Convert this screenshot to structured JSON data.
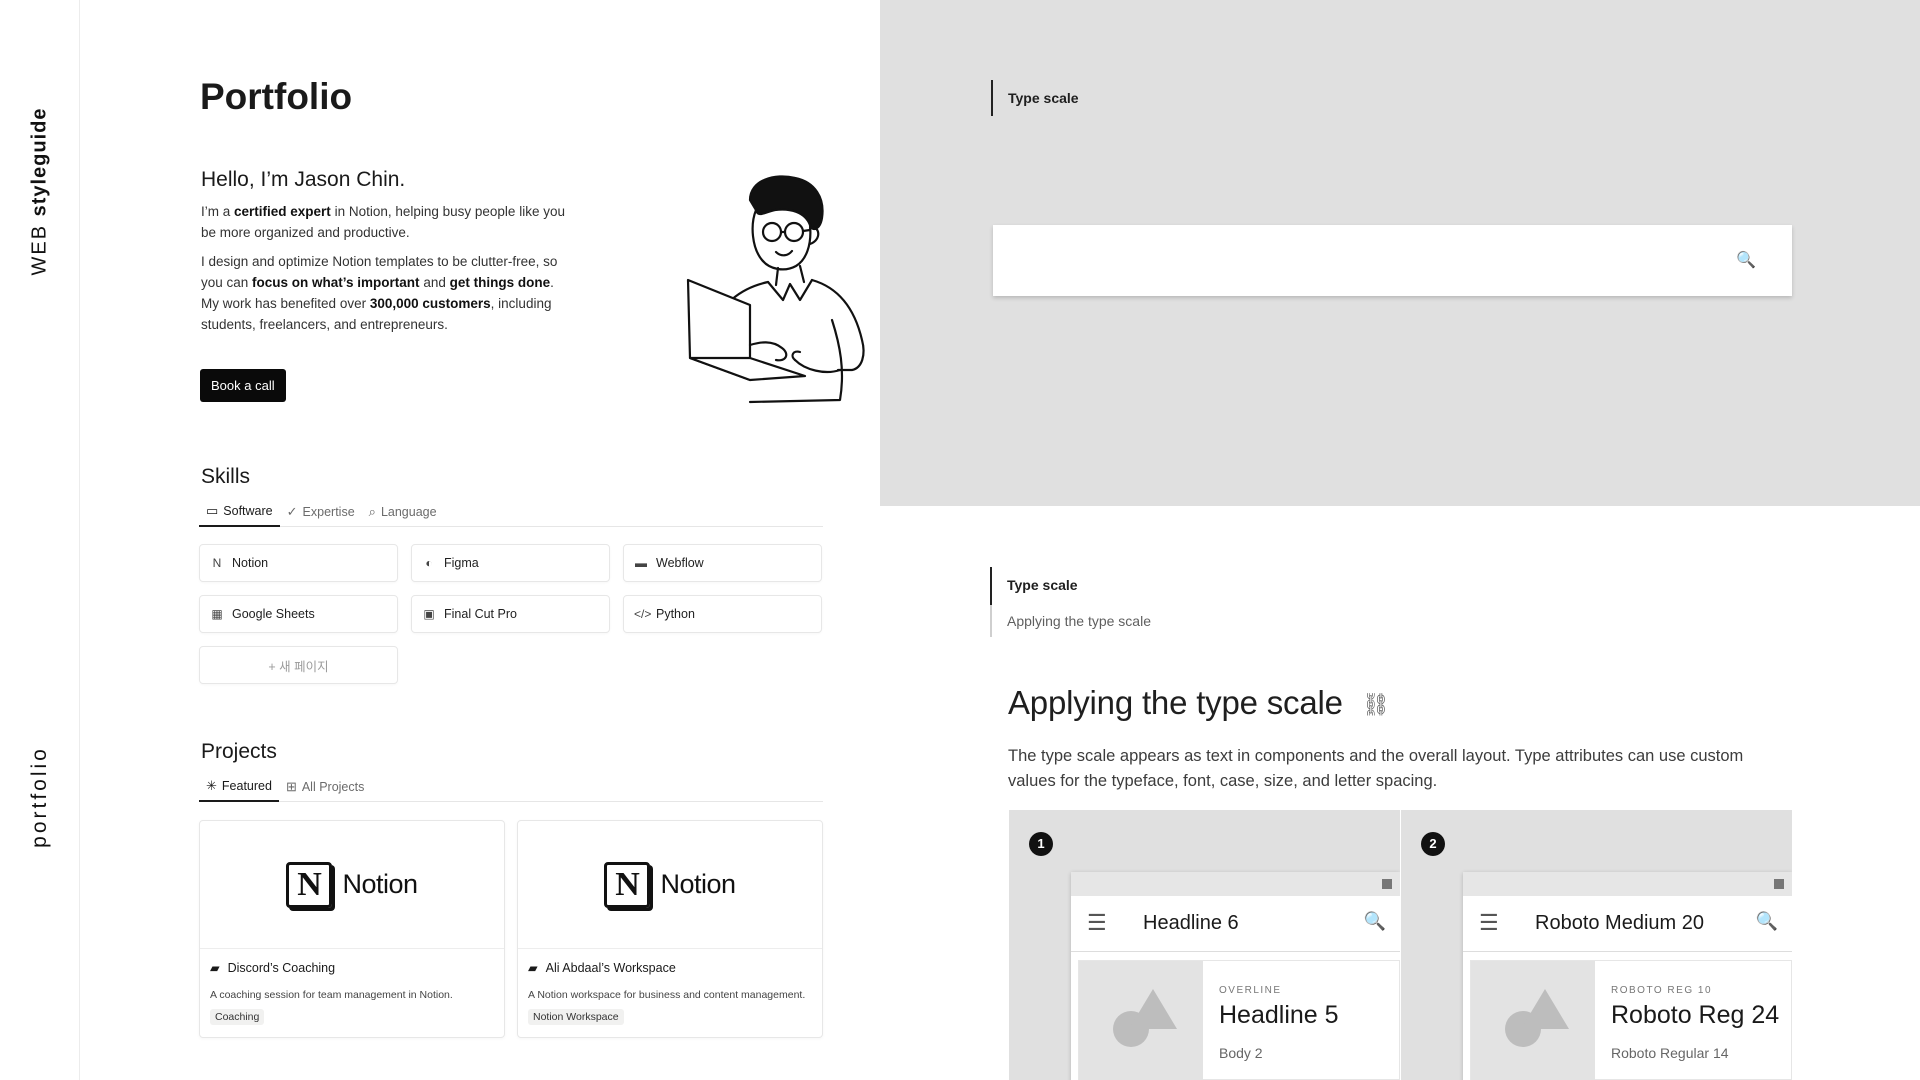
{
  "rail": {
    "top_light": "WEB ",
    "top_bold": "styleguide",
    "bottom": "portfolio"
  },
  "portfolio": {
    "title": "Portfolio",
    "hello": "Hello, I’m Jason Chin.",
    "intro1": {
      "a": "I’m a ",
      "b": "certified expert",
      "c": " in Notion, helping busy people like you be more organized and productive."
    },
    "intro2": {
      "a": "I design and optimize Notion templates to be clutter-free, so you can ",
      "b": "focus on what’s important",
      "c": " and ",
      "d": "get things done",
      "e": ". My work has benefited over ",
      "f": "300,000 customers",
      "g": ", including students, freelancers, and entrepreneurs."
    },
    "book_button": "Book a call",
    "skills": {
      "title": "Skills",
      "tabs": [
        {
          "icon": "▭",
          "label": "Software"
        },
        {
          "icon": "✓",
          "label": "Expertise"
        },
        {
          "icon": "⌕",
          "label": "Language"
        }
      ],
      "items": [
        {
          "icon": "N",
          "label": "Notion"
        },
        {
          "icon": "◐",
          "label": "Figma"
        },
        {
          "icon": "▬",
          "label": "Webflow"
        },
        {
          "icon": "▦",
          "label": "Google Sheets"
        },
        {
          "icon": "▣",
          "label": "Final Cut Pro"
        },
        {
          "icon": "</>",
          "label": "Python"
        }
      ],
      "new_page": "+ 새 페이지"
    },
    "projects": {
      "title": "Projects",
      "tabs": [
        {
          "icon": "✳",
          "label": "Featured"
        },
        {
          "icon": "⊞",
          "label": "All Projects"
        }
      ],
      "cards": [
        {
          "logo_letter": "N",
          "logo_word": "Notion",
          "folder_icon": "▰",
          "title": "Discord’s Coaching",
          "desc": "A coaching session for team management in Notion.",
          "tag": "Coaching"
        },
        {
          "logo_letter": "N",
          "logo_word": "Notion",
          "folder_icon": "▰",
          "title": "Ali Abdaal’s Workspace",
          "desc": "A Notion workspace for business and content management.",
          "tag": "Notion Workspace"
        }
      ]
    }
  },
  "styleguide": {
    "top_label": "Type scale",
    "search_icon": "🔍",
    "label_title": "Type scale",
    "label_sub": "Applying the type scale",
    "heading": "Applying the type scale",
    "link_icon": "⛓",
    "description": "The type scale appears as text in components and the overall layout. Type attributes can use custom values for the typeface, font, case, size, and letter spacing.",
    "demos": [
      {
        "number": "1",
        "appbar_title": "Headline 6",
        "overline": "OVERLINE",
        "headline": "Headline 5",
        "body": "Body 2"
      },
      {
        "number": "2",
        "appbar_title": "Roboto Medium 20",
        "overline": "ROBOTO REG 10",
        "headline": "Roboto Reg 24",
        "body": "Roboto Regular 14"
      }
    ],
    "menu_icon": "☰",
    "appbar_search_icon": "🔍"
  }
}
